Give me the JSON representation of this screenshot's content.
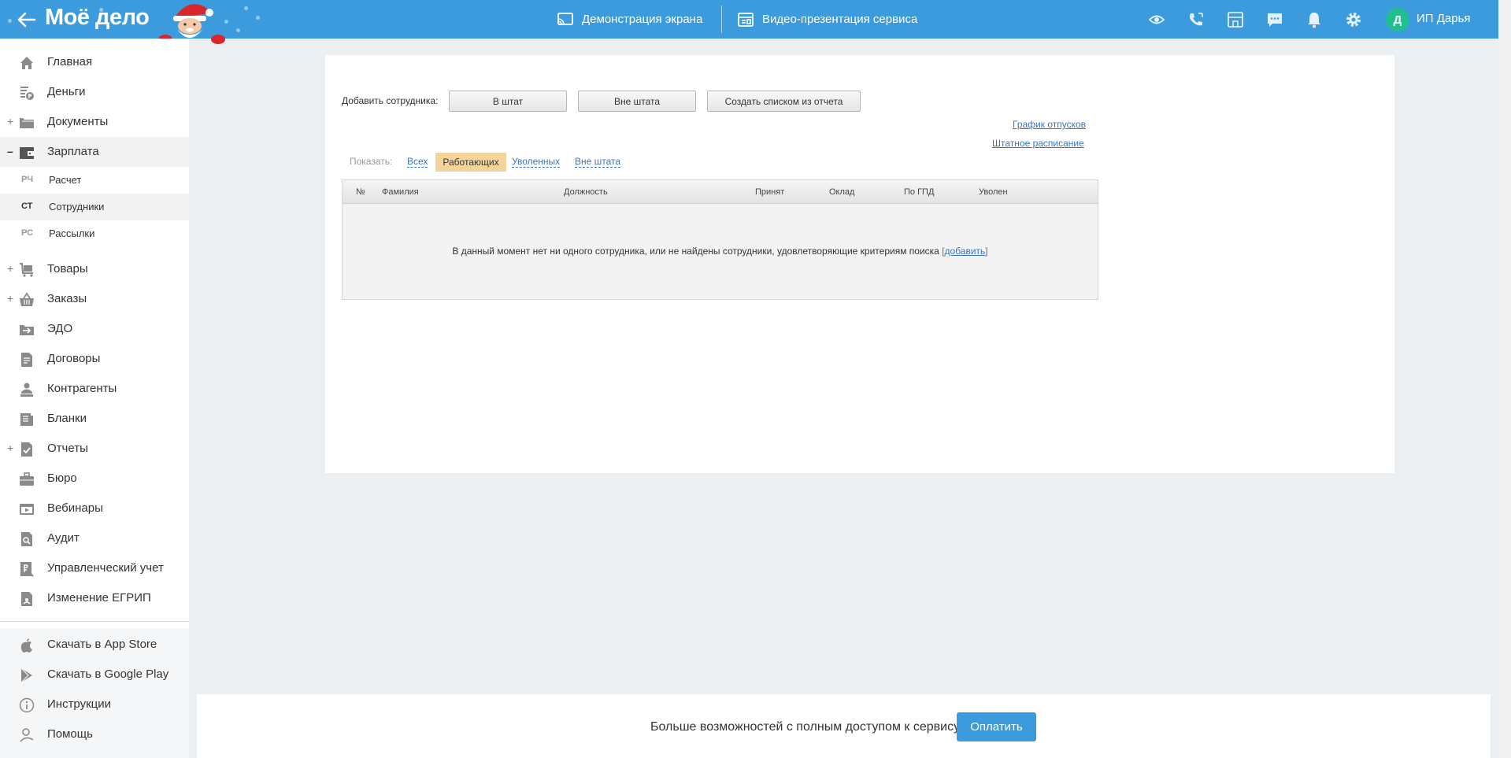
{
  "header": {
    "logo": "Моё дело",
    "screen_demo": "Демонстрация экрана",
    "video_presentation": "Видео-презентация сервиса",
    "avatar_letter": "Д",
    "user_name": "ИП Дарья",
    "bg_color": "#3b9bdc"
  },
  "sidebar": {
    "items": [
      {
        "label": "Главная",
        "icon": "home-icon"
      },
      {
        "label": "Деньги",
        "icon": "money-icon"
      },
      {
        "label": "Документы",
        "icon": "folder-icon"
      },
      {
        "label": "Зарплата",
        "icon": "wallet-icon"
      },
      {
        "label": "Товары",
        "icon": "cart-icon"
      },
      {
        "label": "Заказы",
        "icon": "basket-icon"
      },
      {
        "label": "ЭДО",
        "icon": "edo-icon"
      },
      {
        "label": "Договоры",
        "icon": "contract-icon"
      },
      {
        "label": "Контрагенты",
        "icon": "contractors-icon"
      },
      {
        "label": "Бланки",
        "icon": "forms-icon"
      },
      {
        "label": "Отчеты",
        "icon": "reports-icon"
      },
      {
        "label": "Бюро",
        "icon": "briefcase-icon"
      },
      {
        "label": "Вебинары",
        "icon": "webinar-icon"
      },
      {
        "label": "Аудит",
        "icon": "audit-icon"
      },
      {
        "label": "Управленческий учет",
        "icon": "management-icon"
      },
      {
        "label": "Изменение ЕГРИП",
        "icon": "egrip-icon"
      }
    ],
    "subitems": [
      {
        "abbr": "РЧ",
        "label": "Расчет"
      },
      {
        "abbr": "СТ",
        "label": "Сотрудники"
      },
      {
        "abbr": "РС",
        "label": "Рассылки"
      }
    ],
    "bottom": [
      {
        "label": "Скачать в App Store",
        "icon": "apple-icon"
      },
      {
        "label": "Скачать в Google Play",
        "icon": "google-play-icon"
      },
      {
        "label": "Инструкции",
        "icon": "info-icon"
      },
      {
        "label": "Помощь",
        "icon": "help-icon"
      }
    ]
  },
  "main": {
    "add_employee_label": "Добавить сотрудника:",
    "btn_staff": "В штат",
    "btn_non_staff": "Вне штата",
    "btn_from_report": "Создать списком из отчета",
    "link_vacation": "График отпусков",
    "link_schedule": "Штатное расписание",
    "filter_label": "Показать:",
    "filter_all": "Всех",
    "filter_working": "Работающих",
    "filter_dismissed": "Уволенных",
    "filter_non_staff": "Вне штата",
    "columns": [
      "№",
      "Фамилия",
      "Должность",
      "Принят",
      "Оклад",
      "По ГПД",
      "Уволен"
    ],
    "empty_message": "В данный момент нет ни одного сотрудника, или не найдены сотрудники, удовлетворяющие критериям поиска",
    "empty_add_link": "[добавить]"
  },
  "promo": {
    "text": "Больше возможностей с полным доступом к сервису",
    "pay_button": "Оплатить"
  }
}
